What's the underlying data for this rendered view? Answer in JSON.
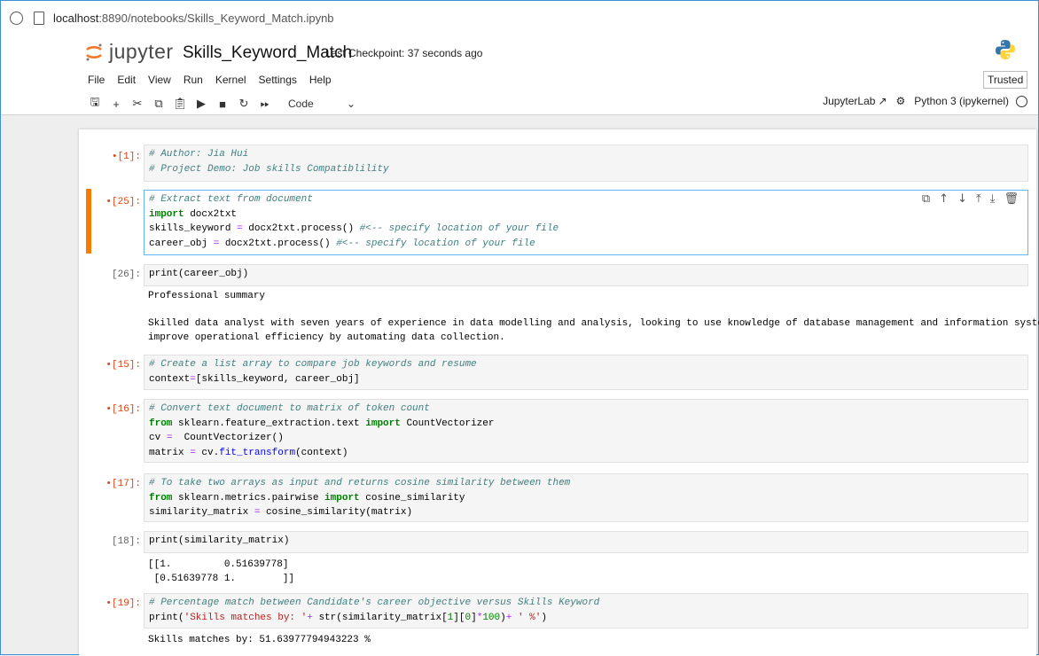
{
  "browser": {
    "url_host": "localhost",
    "url_rest": ":8890/notebooks/Skills_Keyword_Match.ipynb"
  },
  "header": {
    "logo_text": "jupyter",
    "notebook_title": "Skills_Keyword_Match",
    "checkpoint": "Last Checkpoint: 37 seconds ago",
    "trusted": "Trusted"
  },
  "menu": [
    "File",
    "Edit",
    "View",
    "Run",
    "Kernel",
    "Settings",
    "Help"
  ],
  "toolbar": {
    "cell_type": "Code",
    "jupyterlab_label": "JupyterLab",
    "kernel_name": "Python 3 (ipykernel)"
  },
  "cells": {
    "c1": {
      "prompt": "•[1]:",
      "lines": [
        "# Author: Jia Hui",
        "# Project Demo: Job skills Compatiblility"
      ]
    },
    "c2": {
      "prompt": "•[25]:",
      "lines": [
        "# Extract text from document",
        "import docx2txt",
        "skills_keyword = docx2txt.process() #<-- specify location of your file",
        "career_obj = docx2txt.process() #<-- specify location of your file"
      ]
    },
    "c3": {
      "prompt": "[26]:",
      "lines": [
        "print(career_obj)"
      ],
      "output": [
        "Professional summary",
        "",
        "Skilled data analyst with seven years of experience in data modelling and analysis, looking to use knowledge of database management and information systems to",
        "improve operational efficiency by automating data collection."
      ]
    },
    "c4": {
      "prompt": "•[15]:",
      "lines": [
        "# Create a list array to compare job keywords and resume",
        "context=[skills_keyword, career_obj]"
      ]
    },
    "c5": {
      "prompt": "•[16]:",
      "lines": [
        "# Convert text document to matrix of token count",
        "from sklearn.feature_extraction.text import CountVectorizer",
        "cv =  CountVectorizer()",
        "matrix = cv.fit_transform(context)"
      ]
    },
    "c6": {
      "prompt": "•[17]:",
      "lines": [
        "# To take two arrays as input and returns cosine similarity between them",
        "from sklearn.metrics.pairwise import cosine_similarity",
        "similarity_matrix = cosine_similarity(matrix)"
      ]
    },
    "c7": {
      "prompt": "[18]:",
      "lines": [
        "print(similarity_matrix)"
      ],
      "output": [
        "[[1.         0.51639778]",
        " [0.51639778 1.        ]]"
      ]
    },
    "c8": {
      "prompt": "•[19]:",
      "lines": [
        "# Percentage match between Candidate's career objective versus Skills Keyword",
        "print('Skills matches by: '+ str(similarity_matrix[1][0]*100)+ ' %')"
      ],
      "output": [
        "Skills matches by: 51.63977794943223 %"
      ]
    }
  },
  "colors": {
    "accent_orange": "#f57c00",
    "selected_border": "#64b5f6",
    "prompt_running": "#d84315"
  }
}
